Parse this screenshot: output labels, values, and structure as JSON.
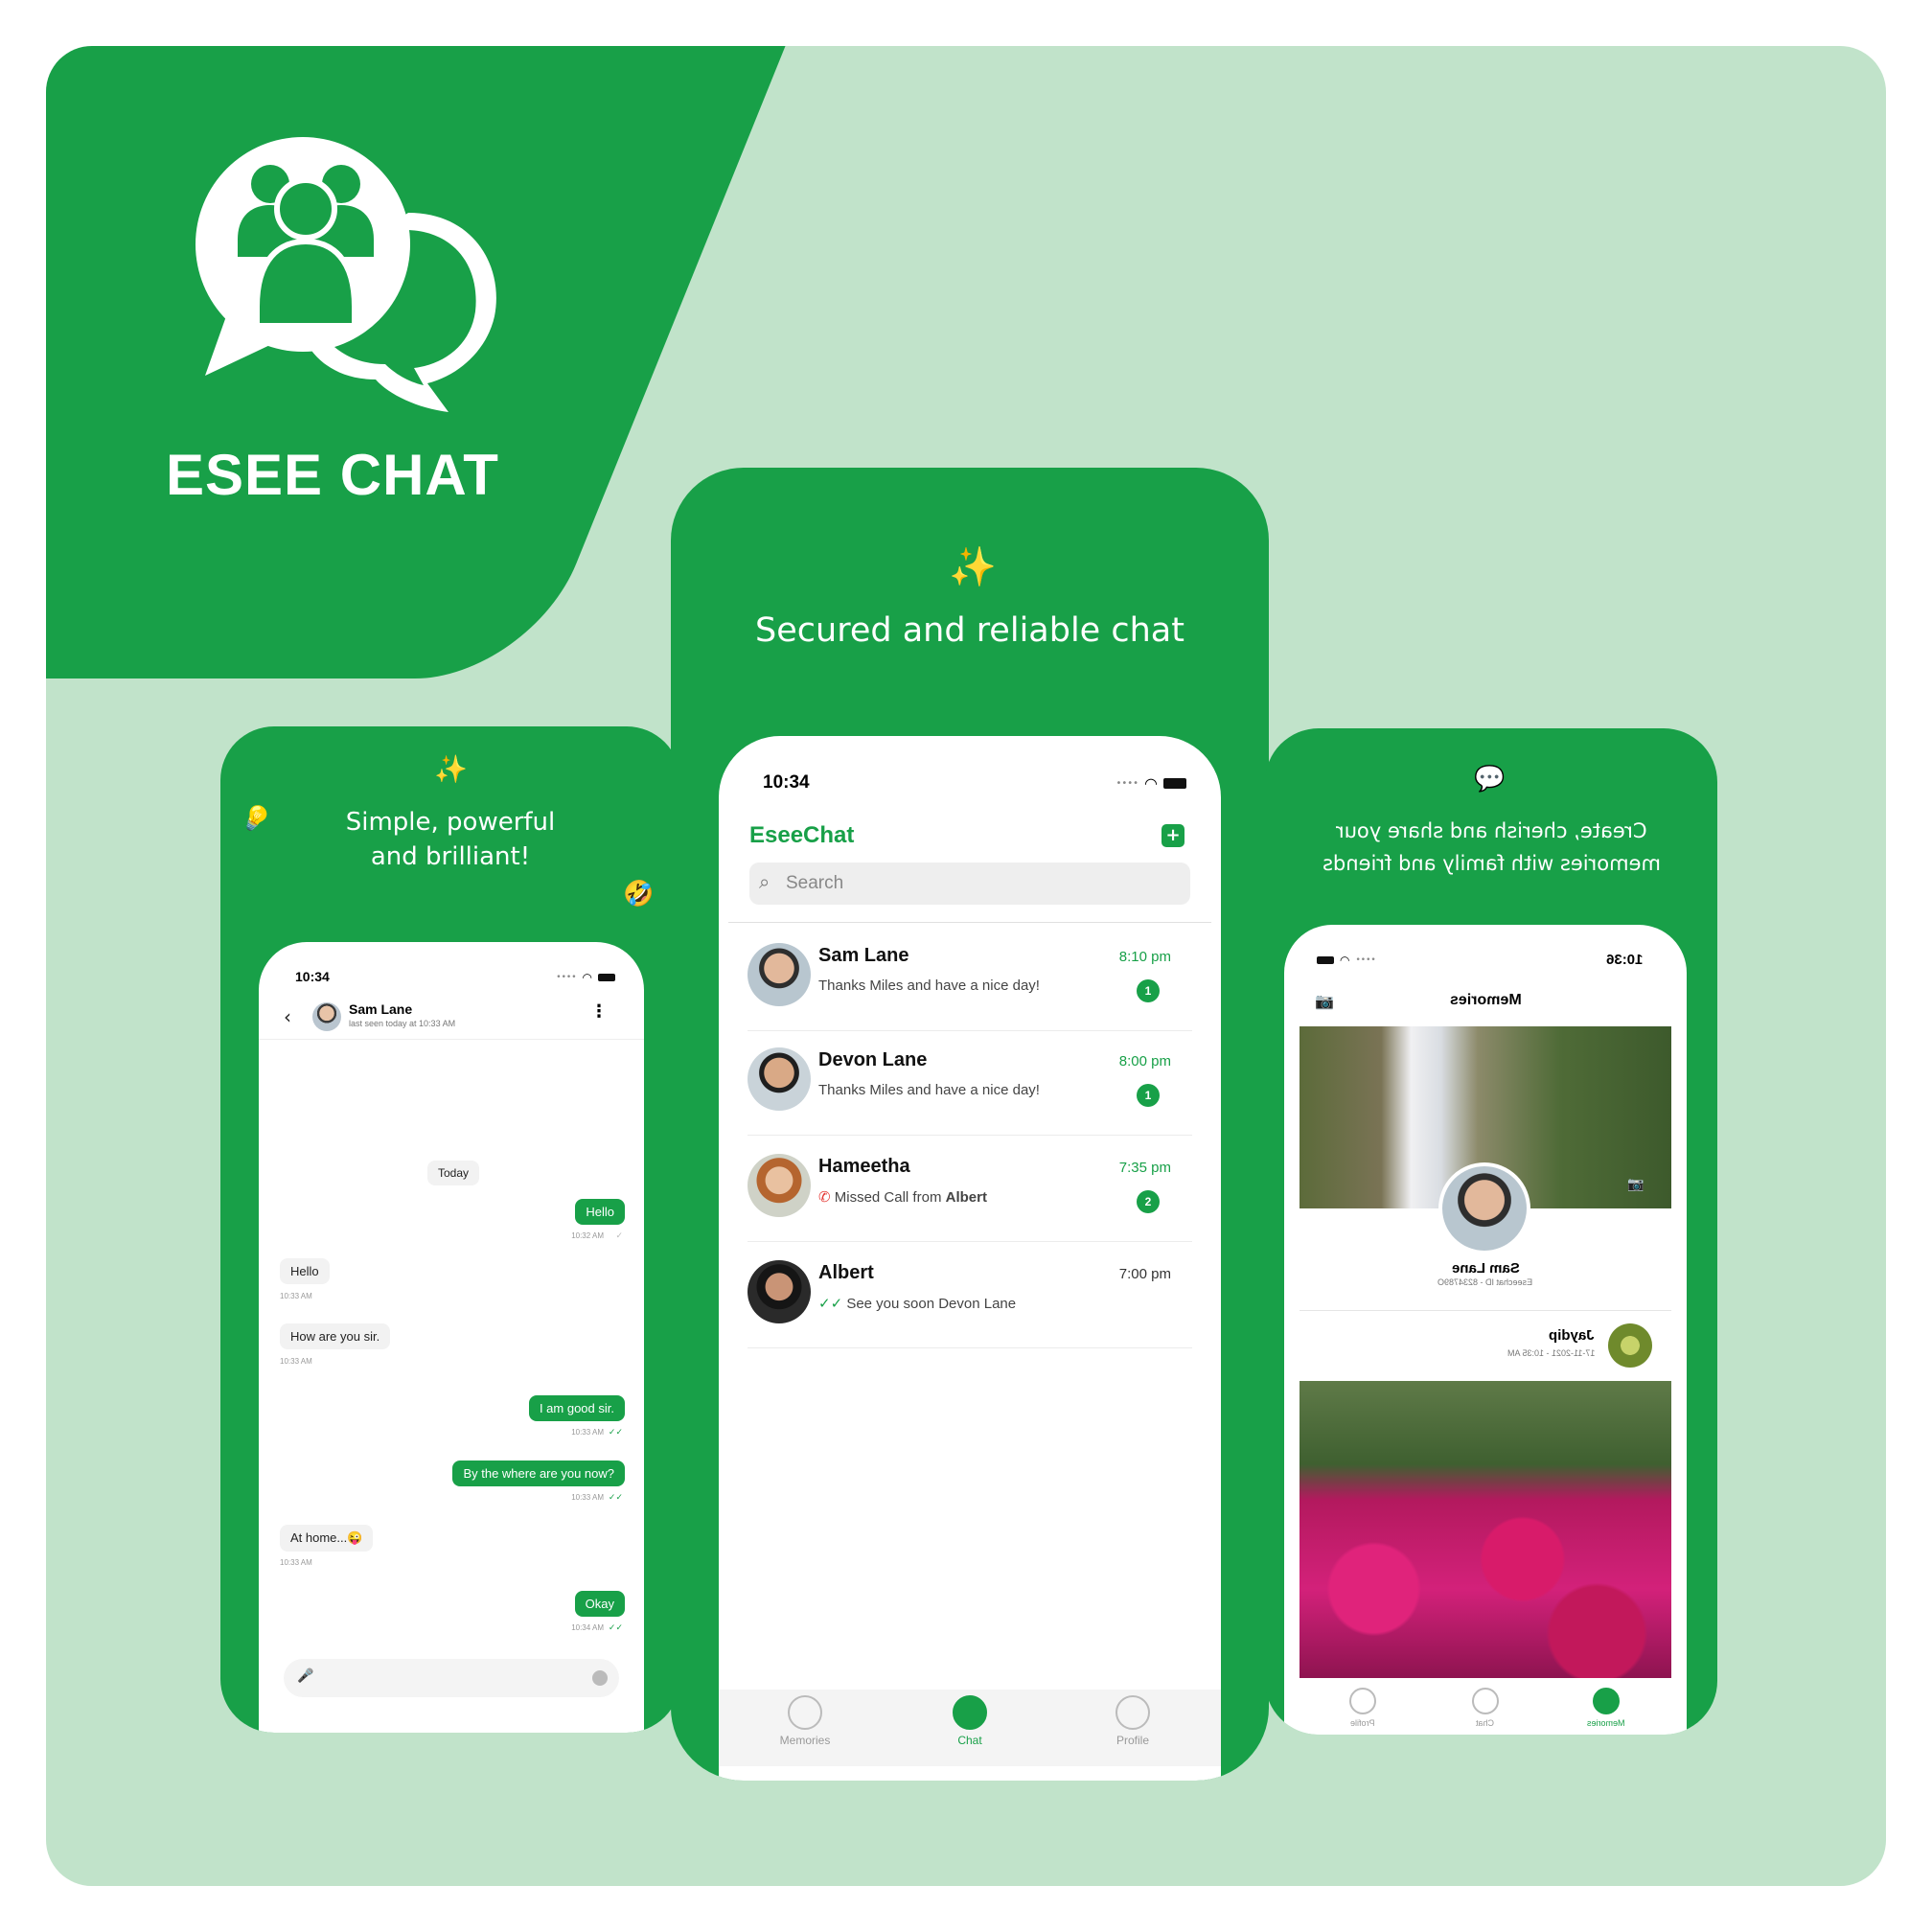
{
  "brand": {
    "name": "ESEE CHAT"
  },
  "colors": {
    "brand_green": "#18a048",
    "background": "#c1e3ca"
  },
  "left_panel": {
    "caption_line1": "Simple, powerful",
    "caption_line2": "and brilliant!",
    "status_time": "10:34",
    "contact_name": "Sam Lane",
    "contact_status": "last seen today at 10:33 AM",
    "day_label": "Today",
    "messages": [
      {
        "text": "Hello",
        "dir": "out",
        "time": "10:32 AM"
      },
      {
        "text": "Hello",
        "dir": "in",
        "time": "10:33 AM"
      },
      {
        "text": "How are you sir.",
        "dir": "in",
        "time": "10:33 AM"
      },
      {
        "text": "I am good sir.",
        "dir": "out",
        "time": "10:33 AM"
      },
      {
        "text": "By the where are you now?",
        "dir": "out",
        "time": "10:33 AM"
      },
      {
        "text": "At home...😜",
        "dir": "in",
        "time": "10:33 AM"
      },
      {
        "text": "Okay",
        "dir": "out",
        "time": "10:34 AM"
      }
    ]
  },
  "center_panel": {
    "caption": "Secured and reliable chat",
    "status_time": "10:34",
    "app_title": "EseeChat",
    "search_placeholder": "Search",
    "chats": [
      {
        "name": "Sam Lane",
        "preview": "Thanks Miles and have a nice day!",
        "time": "8:10 pm",
        "unread": "1"
      },
      {
        "name": "Devon Lane",
        "preview": "Thanks Miles and have a nice day!",
        "time": "8:00 pm",
        "unread": "1"
      },
      {
        "name": "Hameetha",
        "preview_prefix": "Missed Call from ",
        "preview_bold": "Albert",
        "time": "7:35 pm",
        "unread": "2"
      },
      {
        "name": "Albert",
        "preview": "See you soon Devon Lane",
        "time": "7:00 pm"
      }
    ],
    "tabs": [
      "Memories",
      "Chat",
      "Profile"
    ]
  },
  "right_panel": {
    "caption_line1": "Create, cherish and share your",
    "caption_line2": "memories with family and friends",
    "status_time": "10:36",
    "screen_title": "Memories",
    "profile_name": "Sam Lane",
    "profile_id": "Eseechat ID - 8234789O",
    "post_author": "Jaydip",
    "post_date": "17-11-2021 - 10:35 AM",
    "tabs": [
      "Memories",
      "Chat",
      "Profile"
    ]
  }
}
